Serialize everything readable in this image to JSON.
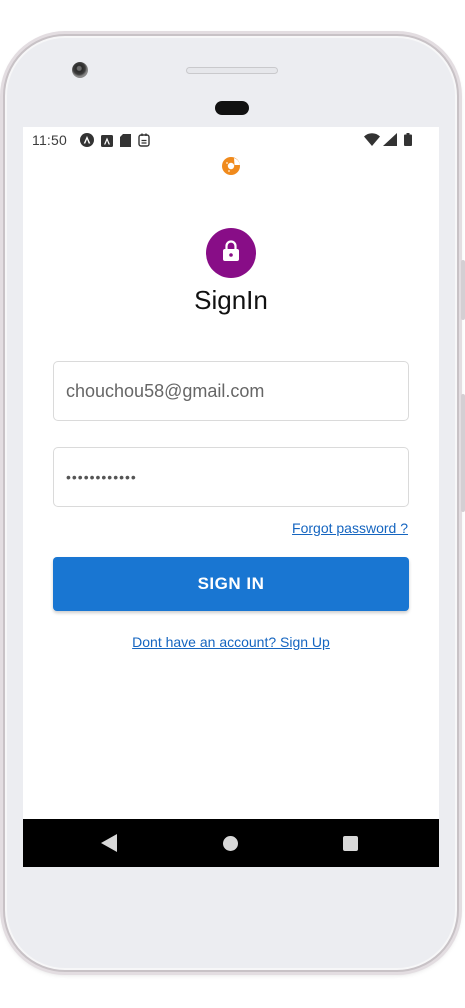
{
  "status_bar": {
    "time": "11:50",
    "left_icons": [
      "android-auto-icon",
      "a-box-icon",
      "sd-card-icon",
      "sync-icon"
    ],
    "right_icons": [
      "wifi-icon",
      "signal-icon",
      "battery-icon"
    ]
  },
  "app": {
    "logo": "donut-logo-icon",
    "title": "SignIn",
    "accent_color": "#880d87",
    "primary_color": "#1976d2"
  },
  "form": {
    "email_value": "chouchou58@gmail.com",
    "password_value": "••••••••••••",
    "forgot_label": "Forgot password ?",
    "signin_label": "SIGN IN",
    "signup_label": "Dont have an account? Sign Up"
  },
  "nav_bar": {
    "icons": [
      "back-icon",
      "home-icon",
      "recents-icon"
    ]
  }
}
